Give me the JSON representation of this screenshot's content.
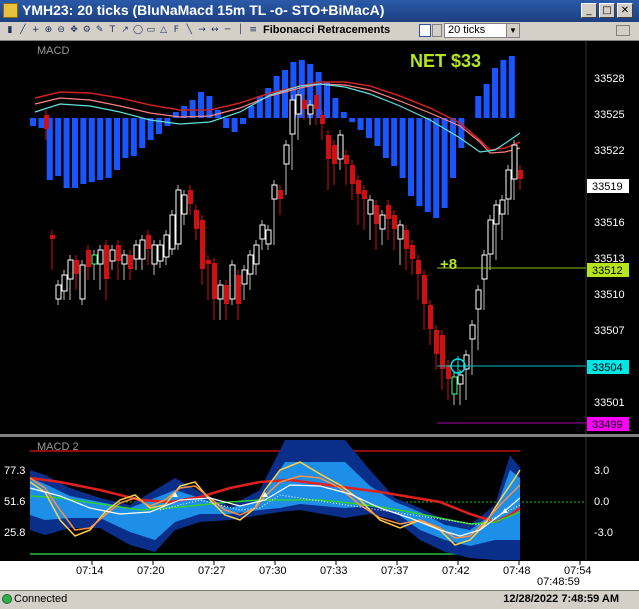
{
  "window": {
    "title": "YMH23: 20 ticks (BluNaMacd 15m TL  -o- STO+BiMacA)"
  },
  "toolbar": {
    "fibonacci_label": "Fibonacci Retracements",
    "interval_value": "20 ticks",
    "icons": [
      "bar-icon",
      "line-icon",
      "crosshair-icon",
      "zoom-in-icon",
      "zoom-out-icon",
      "pan-icon",
      "properties-icon",
      "draw-icon",
      "text-icon",
      "arrow-icon",
      "ellipse-icon",
      "rectangle-icon",
      "triangle-icon",
      "fibonacci-icon",
      "trendline-icon",
      "ray-icon",
      "extended-line-icon",
      "horizontal-line-icon",
      "vertical-line-icon",
      "channel-icon"
    ]
  },
  "price_panel": {
    "label": "MACD",
    "net_text": "NET $33",
    "trade_label": "+8",
    "price_ticks": [
      "33528",
      "33525",
      "33522",
      "33519",
      "33516",
      "33513",
      "33510",
      "33507",
      "33504",
      "33501"
    ],
    "markers": [
      {
        "value": "33519",
        "color": "#ffffff",
        "text_color": "#000000"
      },
      {
        "value": "33512",
        "color": "#b5e61d",
        "text_color": "#000000"
      },
      {
        "value": "33504",
        "color": "#00e5e5",
        "text_color": "#000000"
      },
      {
        "value": "33499",
        "color": "#ff00ff",
        "text_color": "#000000"
      }
    ],
    "colors": {
      "up_candle": "#ffffff",
      "down_candle": "#d01010",
      "signal_candle": "#40ff80",
      "macd_bar": "#1a56ff",
      "net": "#b5e61d"
    }
  },
  "macd_panel": {
    "label": "MACD 2",
    "left_ticks": [
      "77.3",
      "51.6",
      "25.8"
    ],
    "right_ticks": [
      "3.0",
      "0.0",
      "-3.0"
    ]
  },
  "time_axis": {
    "labels": [
      "07:14",
      "07:20",
      "07:27",
      "07:30",
      "07:33",
      "07:37",
      "07:42",
      "07:48",
      "07:54"
    ],
    "clock": "07:48:59"
  },
  "status": {
    "connection": "Connected",
    "datetime": "12/28/2022 7:48:59 AM"
  }
}
